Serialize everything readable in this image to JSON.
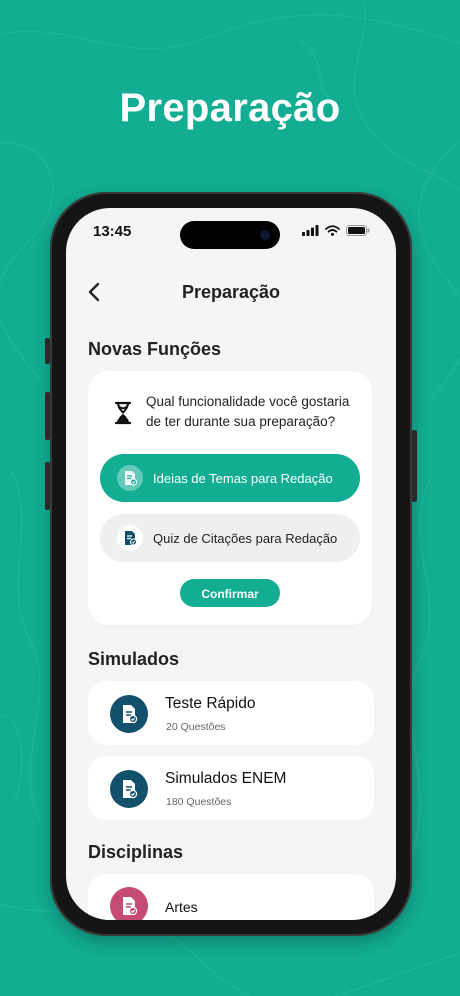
{
  "headline": "Preparação",
  "status_bar": {
    "time": "13:45"
  },
  "header": {
    "title": "Preparação"
  },
  "new_features": {
    "section_title": "Novas Funções",
    "question": "Qual funcionalidade você gostaria de ter durante sua preparação?",
    "options": [
      {
        "label": "Ideias de Temas para Redação",
        "selected": true
      },
      {
        "label": "Quiz de Citações para Redação",
        "selected": false
      }
    ],
    "confirm_label": "Confirmar"
  },
  "simulations": {
    "section_title": "Simulados",
    "items": [
      {
        "title": "Teste Rápido",
        "subtitle": "20 Questões"
      },
      {
        "title": "Simulados ENEM",
        "subtitle": "180 Questões"
      }
    ]
  },
  "subjects": {
    "section_title": "Disciplinas",
    "items": [
      {
        "title": "Artes"
      }
    ]
  },
  "colors": {
    "brand": "#12ad92",
    "sim_icon": "#12506b",
    "subject_icon_artes": "#c54b73"
  },
  "icons": {
    "back": "chevron-left-icon",
    "question": "hourglass-icon",
    "document": "document-check-icon"
  }
}
